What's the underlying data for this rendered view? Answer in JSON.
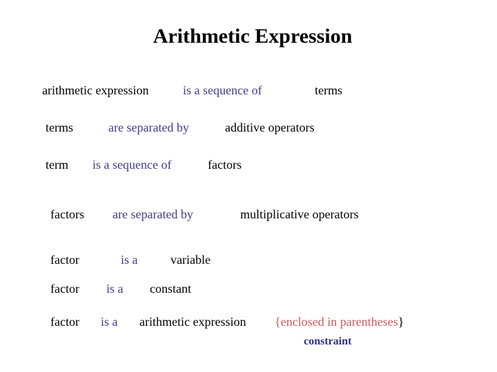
{
  "title": "Arithmetic Expression",
  "colors": {
    "relation": "#3d3d8f",
    "constraint_text": "#d05a5a",
    "constraint_label": "#2e2e86"
  },
  "rules": [
    {
      "subject": "arithmetic expression",
      "relation": "is a sequence of",
      "object": "terms"
    },
    {
      "subject": "terms",
      "relation": "are separated by",
      "object": "additive operators"
    },
    {
      "subject": "term",
      "relation": "is a sequence of",
      "object": "factors"
    },
    {
      "subject": "factors",
      "relation": "are separated by",
      "object": "multiplicative operators"
    },
    {
      "subject": "factor",
      "relation": "is a",
      "object": "variable"
    },
    {
      "subject": "factor",
      "relation": "is a",
      "object": "constant"
    },
    {
      "subject": "factor",
      "relation": "is a",
      "object": "arithmetic expression",
      "constraint_open": "{",
      "constraint_text": "enclosed in parentheses",
      "constraint_close": "}",
      "constraint_label": "constraint"
    }
  ]
}
